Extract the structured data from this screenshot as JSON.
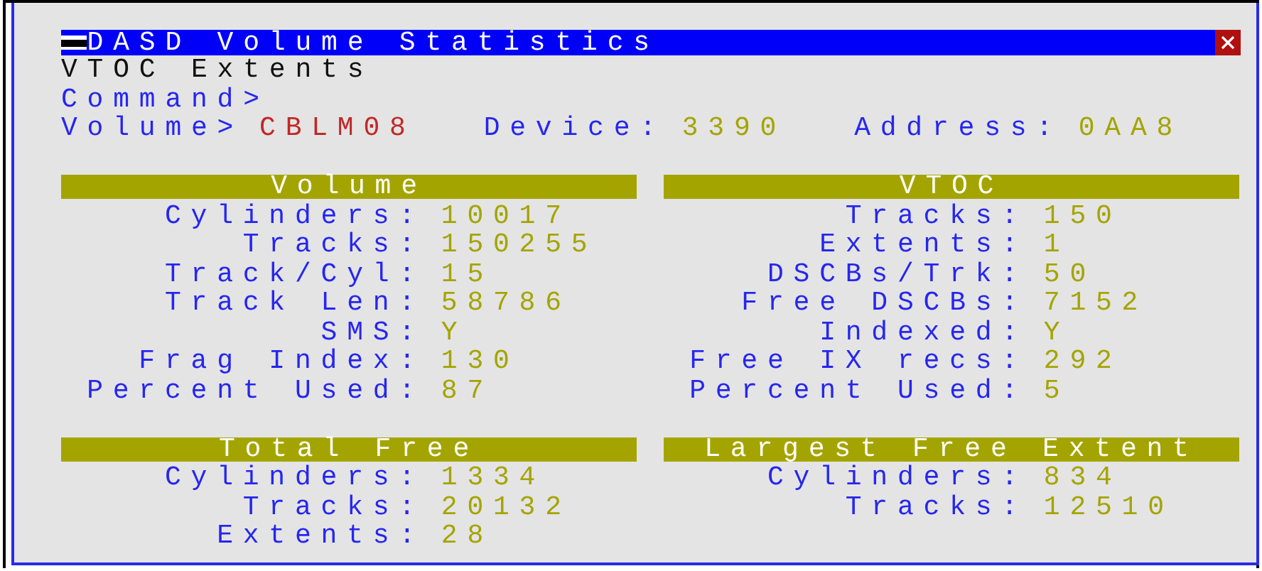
{
  "window": {
    "title": "DASD Volume Statistics",
    "subtitle": "VTOC Extents"
  },
  "command": {
    "label": "Command>"
  },
  "volume_line": {
    "label": "Volume>",
    "volume": "CBLM08",
    "device_label": "Device:",
    "device": "3390",
    "address_label": "Address:",
    "address": "0AA8"
  },
  "panel_rows": [
    [
      {
        "title": "Volume",
        "rows": [
          {
            "label": "Cylinders:",
            "value": "10017"
          },
          {
            "label": "Tracks:",
            "value": "150255"
          },
          {
            "label": "Track/Cyl:",
            "value": "15"
          },
          {
            "label": "Track Len:",
            "value": "58786"
          },
          {
            "label": "SMS:",
            "value": "Y"
          },
          {
            "label": "Frag Index:",
            "value": "130"
          },
          {
            "label": "Percent Used:",
            "value": "87"
          }
        ]
      },
      {
        "title": "VTOC",
        "rows": [
          {
            "label": "Tracks:",
            "value": "150"
          },
          {
            "label": "Extents:",
            "value": "1"
          },
          {
            "label": "DSCBs/Trk:",
            "value": "50"
          },
          {
            "label": "Free DSCBs:",
            "value": "7152"
          },
          {
            "label": "Indexed:",
            "value": "Y"
          },
          {
            "label": "Free IX recs:",
            "value": "292"
          },
          {
            "label": "Percent Used:",
            "value": "5"
          }
        ]
      }
    ],
    [
      {
        "title": "Total Free",
        "rows": [
          {
            "label": "Cylinders:",
            "value": "1334"
          },
          {
            "label": "Tracks:",
            "value": "20132"
          },
          {
            "label": "Extents:",
            "value": "28"
          }
        ]
      },
      {
        "title": "Largest Free Extent",
        "rows": [
          {
            "label": "Cylinders:",
            "value": "834"
          },
          {
            "label": "Tracks:",
            "value": "12510"
          }
        ]
      }
    ]
  ]
}
